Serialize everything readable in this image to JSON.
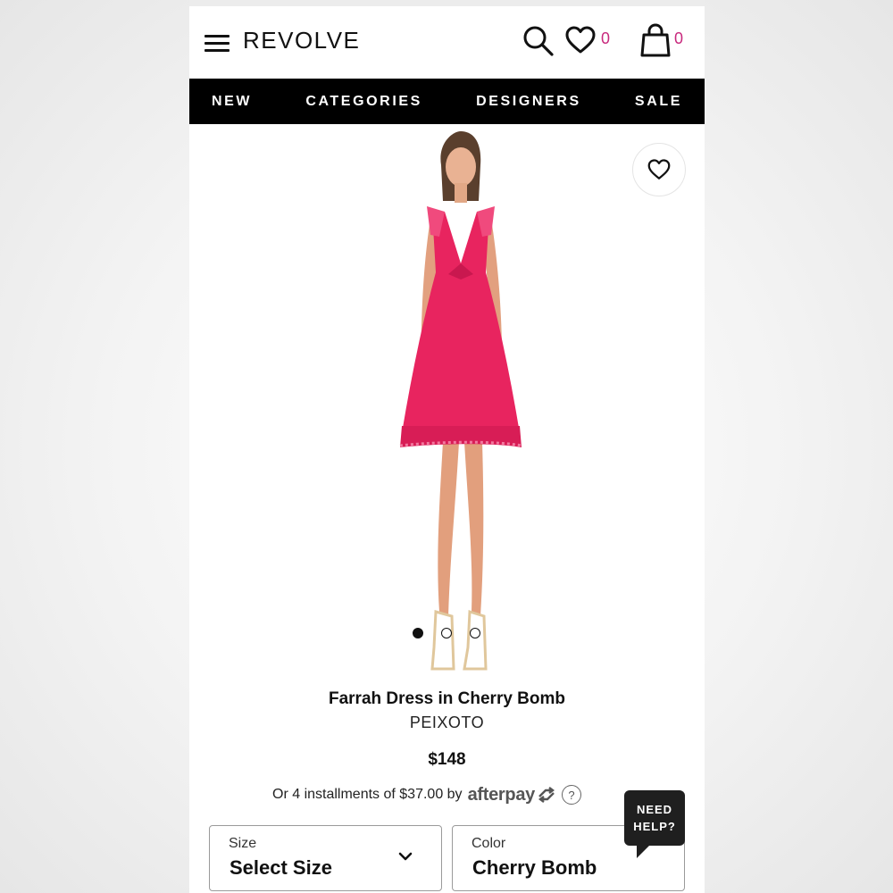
{
  "header": {
    "logo": "REVOLVE",
    "wishlist_count": "0",
    "bag_count": "0",
    "icons": [
      "menu-icon",
      "search-icon",
      "heart-icon",
      "shopping-bag-icon"
    ]
  },
  "nav": {
    "items": [
      "NEW",
      "CATEGORIES",
      "DESIGNERS",
      "SALE"
    ]
  },
  "gallery": {
    "image_count": 3,
    "active_index": 0
  },
  "product": {
    "title": "Farrah Dress in Cherry Bomb",
    "brand": "PEIXOTO",
    "price": "$148",
    "installments_text": "Or 4 installments of $37.00 by",
    "afterpay_label": "afterpay",
    "help_glyph": "?"
  },
  "selectors": {
    "size_label": "Size",
    "size_value": "Select Size",
    "color_label": "Color",
    "color_value": "Cherry Bomb"
  },
  "chat": {
    "line1": "NEED",
    "line2": "HELP?"
  },
  "colors": {
    "accent_count": "#c8297d",
    "dress": "#e8245f",
    "nav_bg": "#000000"
  }
}
